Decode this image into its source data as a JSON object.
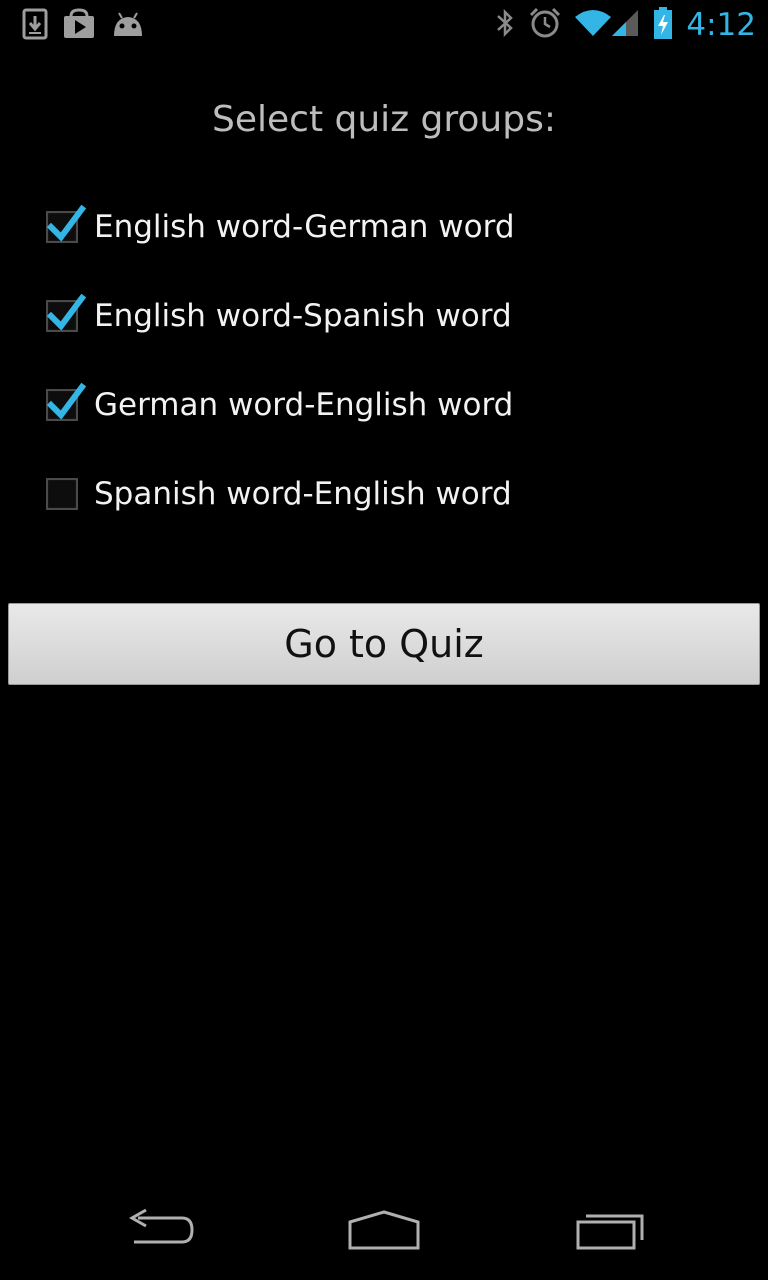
{
  "status_bar": {
    "left_icons": [
      "download-icon",
      "play-store-icon",
      "android-icon"
    ],
    "right_icons": [
      "bluetooth-icon",
      "alarm-icon",
      "wifi-icon",
      "signal-icon",
      "battery-charging-icon"
    ],
    "time": "4:12",
    "accent_color": "#33b5e5"
  },
  "screen": {
    "title": "Select quiz groups:",
    "options": [
      {
        "label": "English word-German word",
        "checked": true
      },
      {
        "label": "English word-Spanish word",
        "checked": true
      },
      {
        "label": "German word-English word",
        "checked": true
      },
      {
        "label": "Spanish word-English word",
        "checked": false
      }
    ],
    "go_button_label": "Go to Quiz"
  },
  "nav_bar": {
    "buttons": [
      "back-icon",
      "home-icon",
      "recent-apps-icon"
    ]
  }
}
